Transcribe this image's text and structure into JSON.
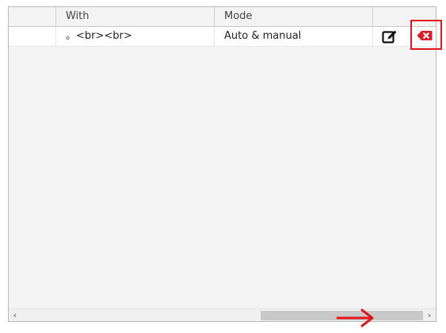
{
  "table": {
    "columns": [
      "",
      "With",
      "Mode",
      ""
    ],
    "rows": [
      {
        "col0": "",
        "with": "。<br><br>",
        "mode": "Auto & manual"
      }
    ],
    "actions": {
      "edit_icon": "edit-icon",
      "delete_icon": "delete-icon"
    }
  },
  "scrollbar": {
    "left_glyph": "‹",
    "right_glyph": "›"
  },
  "colors": {
    "delete_red": "#e01b24",
    "annotation_red": "#e2161b",
    "scroll_thumb": "#c8c8c8"
  }
}
